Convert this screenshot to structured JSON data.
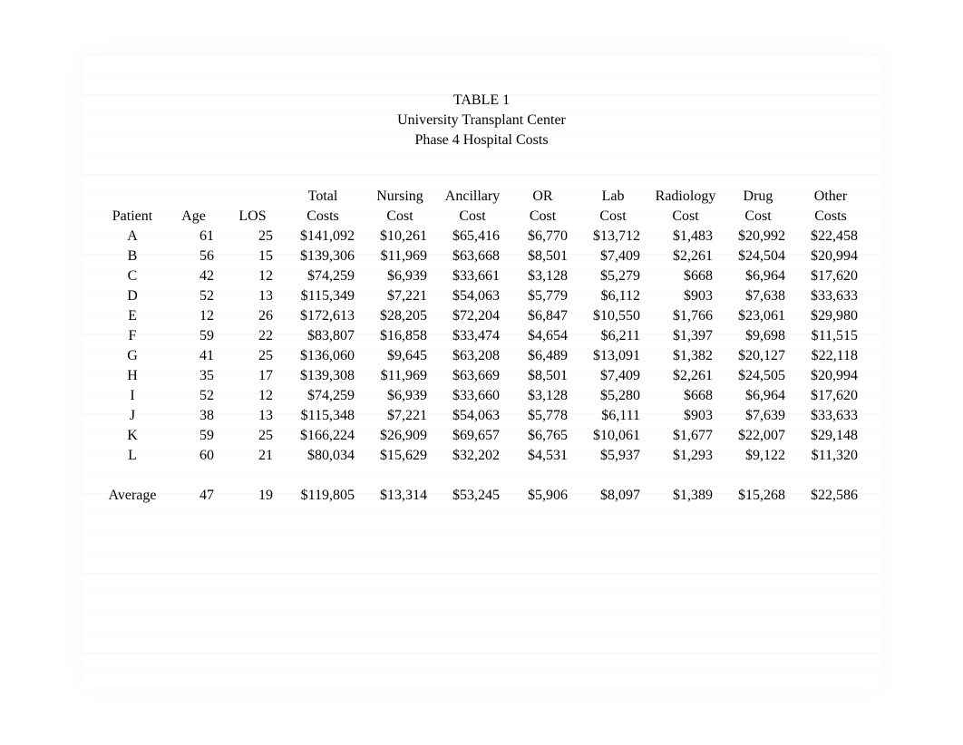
{
  "title": {
    "line1": "TABLE 1",
    "line2": "University Transplant Center",
    "line3": "Phase 4 Hospital Costs"
  },
  "headers": {
    "patient": "Patient",
    "age": "Age",
    "los": "LOS",
    "total_l1": "Total",
    "total_l2": "Costs",
    "nursing_l1": "Nursing",
    "nursing_l2": "Cost",
    "ancillary_l1": "Ancillary",
    "ancillary_l2": "Cost",
    "or_l1": "OR",
    "or_l2": "Cost",
    "lab_l1": "Lab",
    "lab_l2": "Cost",
    "radiology_l1": "Radiology",
    "radiology_l2": "Cost",
    "drug_l1": "Drug",
    "drug_l2": "Cost",
    "other_l1": "Other",
    "other_l2": "Costs"
  },
  "rows": [
    {
      "patient": "A",
      "age": "61",
      "los": "25",
      "total": "$141,092",
      "nursing": "$10,261",
      "ancillary": "$65,416",
      "or": "$6,770",
      "lab": "$13,712",
      "radiology": "$1,483",
      "drug": "$20,992",
      "other": "$22,458"
    },
    {
      "patient": "B",
      "age": "56",
      "los": "15",
      "total": "$139,306",
      "nursing": "$11,969",
      "ancillary": "$63,668",
      "or": "$8,501",
      "lab": "$7,409",
      "radiology": "$2,261",
      "drug": "$24,504",
      "other": "$20,994"
    },
    {
      "patient": "C",
      "age": "42",
      "los": "12",
      "total": "$74,259",
      "nursing": "$6,939",
      "ancillary": "$33,661",
      "or": "$3,128",
      "lab": "$5,279",
      "radiology": "$668",
      "drug": "$6,964",
      "other": "$17,620"
    },
    {
      "patient": "D",
      "age": "52",
      "los": "13",
      "total": "$115,349",
      "nursing": "$7,221",
      "ancillary": "$54,063",
      "or": "$5,779",
      "lab": "$6,112",
      "radiology": "$903",
      "drug": "$7,638",
      "other": "$33,633"
    },
    {
      "patient": "E",
      "age": "12",
      "los": "26",
      "total": "$172,613",
      "nursing": "$28,205",
      "ancillary": "$72,204",
      "or": "$6,847",
      "lab": "$10,550",
      "radiology": "$1,766",
      "drug": "$23,061",
      "other": "$29,980"
    },
    {
      "patient": "F",
      "age": "59",
      "los": "22",
      "total": "$83,807",
      "nursing": "$16,858",
      "ancillary": "$33,474",
      "or": "$4,654",
      "lab": "$6,211",
      "radiology": "$1,397",
      "drug": "$9,698",
      "other": "$11,515"
    },
    {
      "patient": "G",
      "age": "41",
      "los": "25",
      "total": "$136,060",
      "nursing": "$9,645",
      "ancillary": "$63,208",
      "or": "$6,489",
      "lab": "$13,091",
      "radiology": "$1,382",
      "drug": "$20,127",
      "other": "$22,118"
    },
    {
      "patient": "H",
      "age": "35",
      "los": "17",
      "total": "$139,308",
      "nursing": "$11,969",
      "ancillary": "$63,669",
      "or": "$8,501",
      "lab": "$7,409",
      "radiology": "$2,261",
      "drug": "$24,505",
      "other": "$20,994"
    },
    {
      "patient": "I",
      "age": "52",
      "los": "12",
      "total": "$74,259",
      "nursing": "$6,939",
      "ancillary": "$33,660",
      "or": "$3,128",
      "lab": "$5,280",
      "radiology": "$668",
      "drug": "$6,964",
      "other": "$17,620"
    },
    {
      "patient": "J",
      "age": "38",
      "los": "13",
      "total": "$115,348",
      "nursing": "$7,221",
      "ancillary": "$54,063",
      "or": "$5,778",
      "lab": "$6,111",
      "radiology": "$903",
      "drug": "$7,639",
      "other": "$33,633"
    },
    {
      "patient": "K",
      "age": "59",
      "los": "25",
      "total": "$166,224",
      "nursing": "$26,909",
      "ancillary": "$69,657",
      "or": "$6,765",
      "lab": "$10,061",
      "radiology": "$1,677",
      "drug": "$22,007",
      "other": "$29,148"
    },
    {
      "patient": "L",
      "age": "60",
      "los": "21",
      "total": "$80,034",
      "nursing": "$15,629",
      "ancillary": "$32,202",
      "or": "$4,531",
      "lab": "$5,937",
      "radiology": "$1,293",
      "drug": "$9,122",
      "other": "$11,320"
    }
  ],
  "average": {
    "label": "Average",
    "age": "47",
    "los": "19",
    "total": "$119,805",
    "nursing": "$13,314",
    "ancillary": "$53,245",
    "or": "$5,906",
    "lab": "$8,097",
    "radiology": "$1,389",
    "drug": "$15,268",
    "other": "$22,586"
  },
  "chart_data": {
    "type": "table",
    "title": "TABLE 1 — University Transplant Center — Phase 4 Hospital Costs",
    "columns": [
      "Patient",
      "Age",
      "LOS",
      "Total Costs",
      "Nursing Cost",
      "Ancillary Cost",
      "OR Cost",
      "Lab Cost",
      "Radiology Cost",
      "Drug Cost",
      "Other Costs"
    ],
    "data": [
      [
        "A",
        61,
        25,
        141092,
        10261,
        65416,
        6770,
        13712,
        1483,
        20992,
        22458
      ],
      [
        "B",
        56,
        15,
        139306,
        11969,
        63668,
        8501,
        7409,
        2261,
        24504,
        20994
      ],
      [
        "C",
        42,
        12,
        74259,
        6939,
        33661,
        3128,
        5279,
        668,
        6964,
        17620
      ],
      [
        "D",
        52,
        13,
        115349,
        7221,
        54063,
        5779,
        6112,
        903,
        7638,
        33633
      ],
      [
        "E",
        12,
        26,
        172613,
        28205,
        72204,
        6847,
        10550,
        1766,
        23061,
        29980
      ],
      [
        "F",
        59,
        22,
        83807,
        16858,
        33474,
        4654,
        6211,
        1397,
        9698,
        11515
      ],
      [
        "G",
        41,
        25,
        136060,
        9645,
        63208,
        6489,
        13091,
        1382,
        20127,
        22118
      ],
      [
        "H",
        35,
        17,
        139308,
        11969,
        63669,
        8501,
        7409,
        2261,
        24505,
        20994
      ],
      [
        "I",
        52,
        12,
        74259,
        6939,
        33660,
        3128,
        5280,
        668,
        6964,
        17620
      ],
      [
        "J",
        38,
        13,
        115348,
        7221,
        54063,
        5778,
        6111,
        903,
        7639,
        33633
      ],
      [
        "K",
        59,
        25,
        166224,
        26909,
        69657,
        6765,
        10061,
        1677,
        22007,
        29148
      ],
      [
        "L",
        60,
        21,
        80034,
        15629,
        32202,
        4531,
        5937,
        1293,
        9122,
        11320
      ]
    ],
    "summary": [
      "Average",
      47,
      19,
      119805,
      13314,
      53245,
      5906,
      8097,
      1389,
      15268,
      22586
    ]
  }
}
